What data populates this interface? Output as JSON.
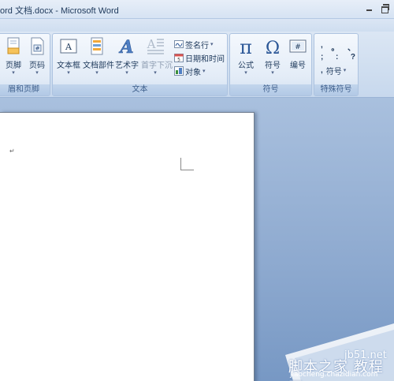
{
  "window": {
    "title": "ord 文档.docx - Microsoft Word"
  },
  "ribbon": {
    "header_footer_group": {
      "label": "眉和页脚",
      "footer_label": "页脚",
      "page_number_label": "页码"
    },
    "text_group": {
      "label": "文本",
      "textbox_label": "文本框",
      "quickparts_label": "文档部件",
      "wordart_label": "艺术字",
      "dropcap_label": "首字下沉",
      "signature_label": "签名行",
      "datetime_label": "日期和时间",
      "object_label": "对象"
    },
    "symbols_group": {
      "label": "符号",
      "equation_label": "公式",
      "symbol_label": "符号",
      "number_label": "编号"
    },
    "special_symbols_group": {
      "label": "特殊符号",
      "row1": [
        ",",
        "。",
        "、"
      ],
      "row2": [
        ";",
        ":",
        "?"
      ],
      "more_label": "符号"
    }
  },
  "document": {
    "paragraph_mark": "↵"
  },
  "watermark": {
    "site": "jb51.net",
    "name": "脚本之家 教程网",
    "url": "jiaocheng.chazidian.com"
  },
  "colors": {
    "ribbon_text": "#1e395b",
    "group_label": "#3e5f8c",
    "workspace_blue": "#8da9cf"
  }
}
